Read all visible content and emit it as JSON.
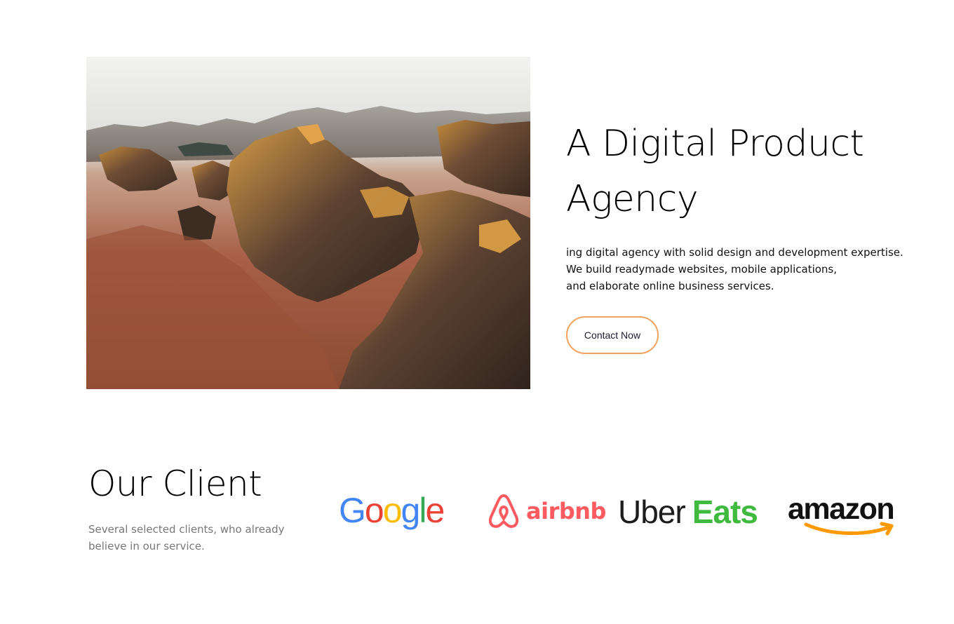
{
  "hero": {
    "title_line1": "A Digital Product",
    "title_line2": "Agency",
    "description_lines": [
      "ing digital agency with solid design and development expertise.",
      "We build readymade websites, mobile applications,",
      "and elaborate online business services."
    ],
    "cta_label": "Contact Now",
    "accent_color": "#f0a35e"
  },
  "clients": {
    "title": "Our Client",
    "description_lines": [
      "Several selected clients, who already",
      "believe in our service."
    ],
    "logos": {
      "google": [
        "G",
        "o",
        "o",
        "g",
        "l",
        "e"
      ],
      "airbnb": "airbnb",
      "uber": "Uber",
      "eats": "Eats",
      "amazon": "amazon"
    }
  }
}
